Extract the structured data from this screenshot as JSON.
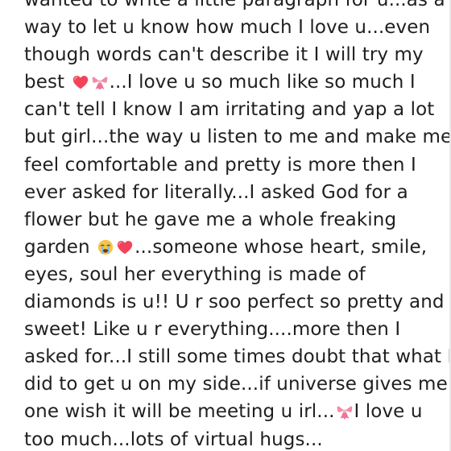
{
  "note": {
    "lines": [
      "wanted to write a little paragraph for u...as a",
      "way to let u know how much I love u...even",
      "though words can't describe it I will try my",
      [
        "best ",
        "...I love u so much like so much I"
      ],
      "can't tell I know I am irritating and yap a lot",
      "but girl...the way u listen to me and make me",
      "feel comfortable and pretty is more then I",
      "ever asked for literally...I asked God for a",
      "flower but he gave me a whole freaking",
      [
        "garden ",
        "...someone whose heart, smile,"
      ],
      "eyes, soul her everything is made of",
      "diamonds is u!! U r soo perfect so pretty and",
      "sweet! Like u r everything....more then I",
      "asked for...I still some times doubt that what I",
      "did to get u on my side...if universe gives me",
      [
        "one wish it will be meeting u irl...",
        "I love u"
      ],
      "too much...lots of virtual hugs..."
    ],
    "emojis": {
      "heart": "red-heart-icon",
      "ribbon": "pink-ribbon-icon",
      "crying": "loudly-crying-face-icon"
    },
    "colors": {
      "text": "#1f1f1f",
      "background": "#ffffff",
      "heart": "#f2435a",
      "ribbon": "#f38aa8",
      "crying_face": "#f6c548",
      "tears": "#66b9ff"
    }
  }
}
